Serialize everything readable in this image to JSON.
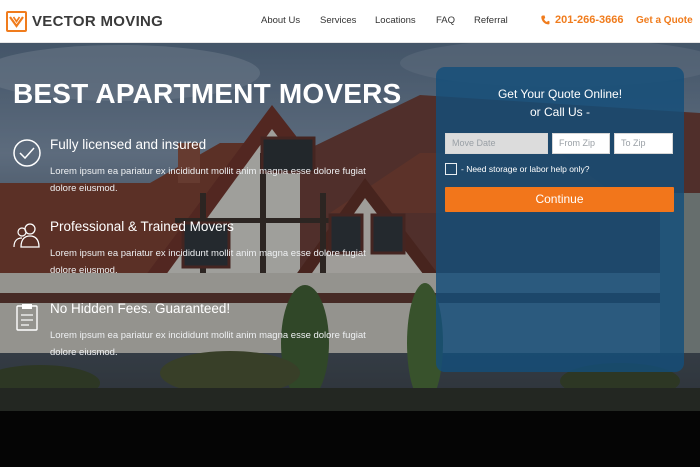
{
  "brand": {
    "name": "VECTOR MOVING",
    "accent": "#f07c1d",
    "panel": "#144e7a"
  },
  "nav": {
    "items": [
      {
        "label": "About Us"
      },
      {
        "label": "Services"
      },
      {
        "label": "Locations"
      },
      {
        "label": "FAQ"
      },
      {
        "label": "Referral"
      }
    ]
  },
  "header": {
    "phone": "201-266-3666",
    "phone_icon": "phone-icon",
    "quote_link": "Get a Quote"
  },
  "hero": {
    "title": "BEST APARTMENT MOVERS",
    "features": [
      {
        "title": "Fully licensed and insured",
        "text": "Lorem ipsum ea pariatur ex incididunt mollit anim magna esse dolore fugiat dolore eiusmod.",
        "icon": "checkmark-circle-icon"
      },
      {
        "title": "Professional & Trained Movers",
        "text": "Lorem ipsum ea pariatur ex incididunt mollit anim magna esse dolore fugiat dolore eiusmod.",
        "icon": "people-icon"
      },
      {
        "title": "No Hidden Fees. Guaranteed!",
        "text": "Lorem ipsum ea pariatur ex incididunt mollit anim magna esse dolore fugiat dolore eiusmod.",
        "icon": "clipboard-icon"
      }
    ]
  },
  "quote_form": {
    "title_line1": "Get Your Quote Online!",
    "title_line2": "or Call Us -",
    "move_date_placeholder": "Move Date",
    "from_zip_placeholder": "From Zip",
    "to_zip_placeholder": "To Zip",
    "storage_checkbox_label": "- Need storage or labor help only?",
    "continue_label": "Continue"
  }
}
